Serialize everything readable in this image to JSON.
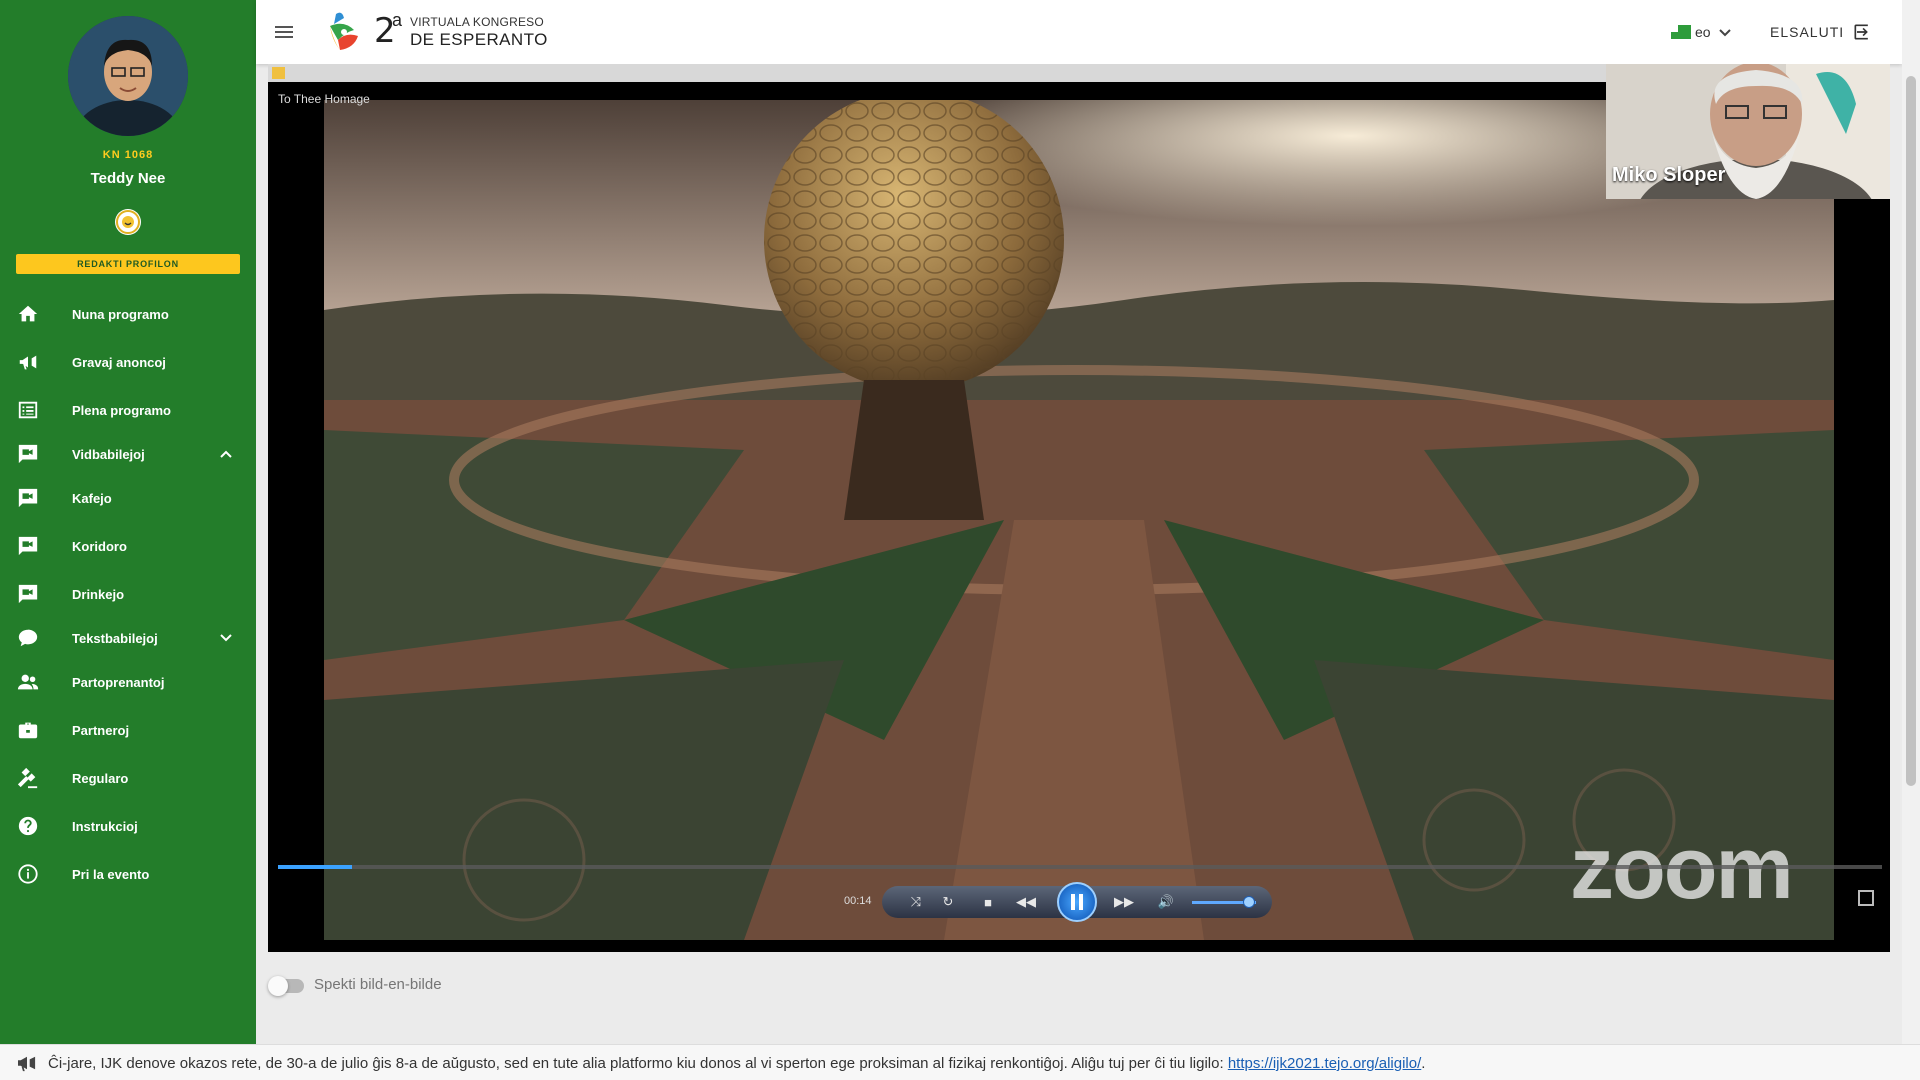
{
  "user": {
    "code": "KN 1068",
    "name": "Teddy Nee",
    "edit_profile_label": "REDAKTI PROFILON"
  },
  "nav": {
    "items": [
      {
        "label": "Nuna programo",
        "icon": "home-icon"
      },
      {
        "label": "Gravaj anoncoj",
        "icon": "megaphone-icon"
      },
      {
        "label": "Plena programo",
        "icon": "list-icon"
      },
      {
        "label": "Vidbabilejoj",
        "icon": "video-chat-icon",
        "expanded": true
      },
      {
        "label": "Kafejo",
        "icon": "video-chat-icon"
      },
      {
        "label": "Koridoro",
        "icon": "video-chat-icon"
      },
      {
        "label": "Drinkejo",
        "icon": "video-chat-icon"
      },
      {
        "label": "Tekstbabilejoj",
        "icon": "chat-bubble-icon",
        "expanded": false
      },
      {
        "label": "Partoprenantoj",
        "icon": "people-icon"
      },
      {
        "label": "Partneroj",
        "icon": "briefcase-icon"
      },
      {
        "label": "Regularo",
        "icon": "gavel-icon"
      },
      {
        "label": "Instrukcioj",
        "icon": "help-icon"
      },
      {
        "label": "Pri la evento",
        "icon": "info-icon"
      }
    ]
  },
  "header": {
    "logo_number": "2",
    "logo_superscript": "a",
    "logo_line1": "VIRTUALA KONGRESO",
    "logo_line2": "DE ESPERANTO",
    "language": "eo",
    "logout_label": "ELSALUTI"
  },
  "video": {
    "title": "To Thee Homage",
    "speaker_name": "Miko Sloper",
    "watermark": "zoom",
    "time": "00:14",
    "progress": 0.046,
    "volume": 0.8
  },
  "pip": {
    "label": "Spekti bild-en-bilde",
    "enabled": false
  },
  "announcement": {
    "text": "Ĉi-jare, IJK denove okazos rete, de 30-a de julio ĝis 8-a de aŭgusto, sed en tute alia platformo kiu donos al vi sperton ege proksiman al fizikaj renkontiĝoj. Aliĝu tuj per ĉi tiu ligilo: ",
    "link": "https://ijk2021.tejo.org/aligilo/",
    "suffix": "."
  },
  "colors": {
    "sidebar": "#237d2a",
    "accent": "#fdc71e",
    "link": "#1a5fb4"
  }
}
